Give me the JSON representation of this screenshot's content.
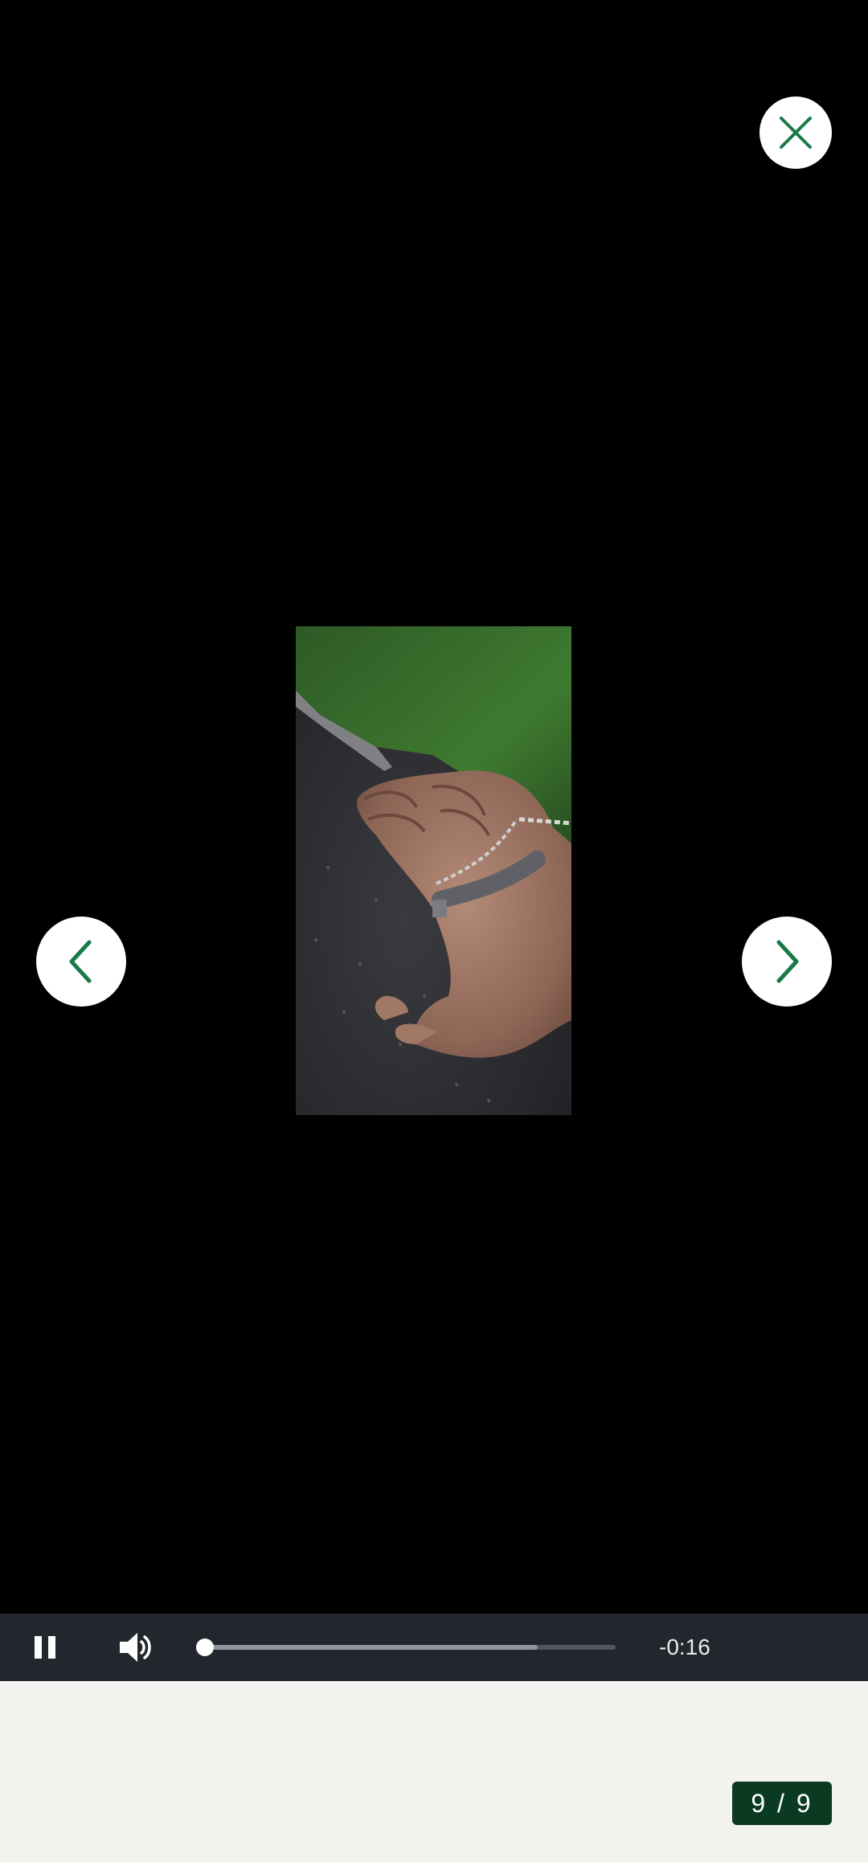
{
  "viewer": {
    "close_icon": "close-icon",
    "prev_icon": "chevron-left-icon",
    "next_icon": "chevron-right-icon",
    "accent_color": "#1a7a46"
  },
  "video": {
    "subject": "dog-photo",
    "is_playing": true,
    "progress_fraction": 0.0,
    "buffered_fraction": 0.81
  },
  "controls": {
    "pause_icon": "pause-icon",
    "volume_icon": "volume-icon",
    "time_remaining": "-0:16",
    "bar_color": "#22262d"
  },
  "gallery": {
    "counter": "9 / 9",
    "counter_bg": "#0b3a23"
  }
}
